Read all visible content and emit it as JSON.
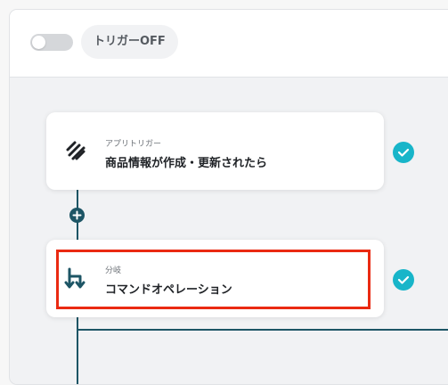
{
  "header": {
    "trigger_status_label": "トリガーOFF"
  },
  "flow": {
    "steps": [
      {
        "subtitle": "アプリトリガー",
        "title": "商品情報が作成・更新されたら",
        "icon": "squarespace-icon",
        "status": "complete"
      },
      {
        "subtitle": "分岐",
        "title": "コマンドオペレーション",
        "icon": "branch-icon",
        "status": "complete"
      }
    ]
  },
  "colors": {
    "accent_teal": "#18b5c9",
    "connector": "#1d5565",
    "highlight": "#ea2a12"
  }
}
